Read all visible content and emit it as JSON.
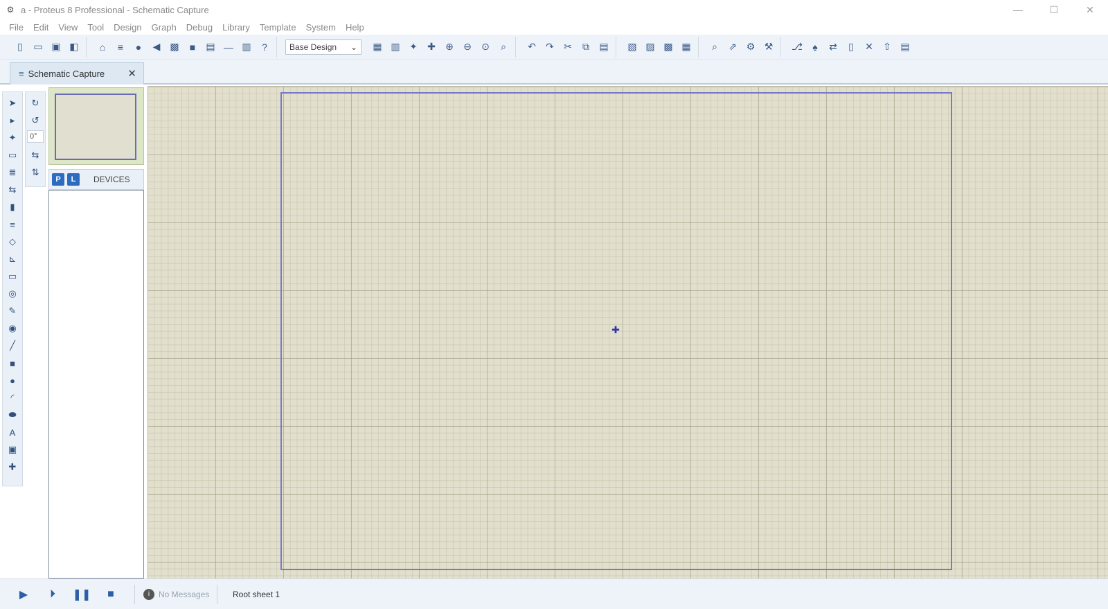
{
  "window": {
    "title": "a - Proteus 8 Professional - Schematic Capture",
    "minimize": "—",
    "maximize": "☐",
    "close": "✕"
  },
  "menu": [
    "File",
    "Edit",
    "View",
    "Tool",
    "Design",
    "Graph",
    "Debug",
    "Library",
    "Template",
    "System",
    "Help"
  ],
  "toolbar": {
    "design_select": "Base Design"
  },
  "tab": {
    "label": "Schematic Capture",
    "close": "✕"
  },
  "devices": {
    "pick_button": "P",
    "library_button": "L",
    "label": "DEVICES"
  },
  "rotation": {
    "angle": "0°"
  },
  "status": {
    "messages": "No Messages",
    "sheet": "Root sheet 1"
  },
  "colors": {
    "canvas": "#e2e0cd",
    "sheet_border": "#7a78c8",
    "toolbar_bg": "#edf3f9",
    "accent": "#2d6bc0"
  }
}
